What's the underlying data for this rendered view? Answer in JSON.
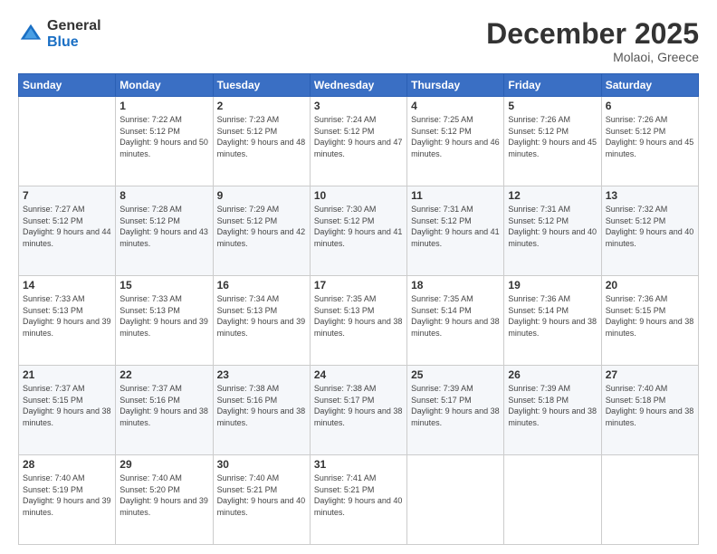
{
  "header": {
    "logo_line1": "General",
    "logo_line2": "Blue",
    "month": "December 2025",
    "location": "Molaoi, Greece"
  },
  "days_of_week": [
    "Sunday",
    "Monday",
    "Tuesday",
    "Wednesday",
    "Thursday",
    "Friday",
    "Saturday"
  ],
  "weeks": [
    [
      {
        "day": "",
        "sunrise": "",
        "sunset": "",
        "daylight": ""
      },
      {
        "day": "1",
        "sunrise": "Sunrise: 7:22 AM",
        "sunset": "Sunset: 5:12 PM",
        "daylight": "Daylight: 9 hours and 50 minutes."
      },
      {
        "day": "2",
        "sunrise": "Sunrise: 7:23 AM",
        "sunset": "Sunset: 5:12 PM",
        "daylight": "Daylight: 9 hours and 48 minutes."
      },
      {
        "day": "3",
        "sunrise": "Sunrise: 7:24 AM",
        "sunset": "Sunset: 5:12 PM",
        "daylight": "Daylight: 9 hours and 47 minutes."
      },
      {
        "day": "4",
        "sunrise": "Sunrise: 7:25 AM",
        "sunset": "Sunset: 5:12 PM",
        "daylight": "Daylight: 9 hours and 46 minutes."
      },
      {
        "day": "5",
        "sunrise": "Sunrise: 7:26 AM",
        "sunset": "Sunset: 5:12 PM",
        "daylight": "Daylight: 9 hours and 45 minutes."
      },
      {
        "day": "6",
        "sunrise": "Sunrise: 7:26 AM",
        "sunset": "Sunset: 5:12 PM",
        "daylight": "Daylight: 9 hours and 45 minutes."
      }
    ],
    [
      {
        "day": "7",
        "sunrise": "Sunrise: 7:27 AM",
        "sunset": "Sunset: 5:12 PM",
        "daylight": "Daylight: 9 hours and 44 minutes."
      },
      {
        "day": "8",
        "sunrise": "Sunrise: 7:28 AM",
        "sunset": "Sunset: 5:12 PM",
        "daylight": "Daylight: 9 hours and 43 minutes."
      },
      {
        "day": "9",
        "sunrise": "Sunrise: 7:29 AM",
        "sunset": "Sunset: 5:12 PM",
        "daylight": "Daylight: 9 hours and 42 minutes."
      },
      {
        "day": "10",
        "sunrise": "Sunrise: 7:30 AM",
        "sunset": "Sunset: 5:12 PM",
        "daylight": "Daylight: 9 hours and 41 minutes."
      },
      {
        "day": "11",
        "sunrise": "Sunrise: 7:31 AM",
        "sunset": "Sunset: 5:12 PM",
        "daylight": "Daylight: 9 hours and 41 minutes."
      },
      {
        "day": "12",
        "sunrise": "Sunrise: 7:31 AM",
        "sunset": "Sunset: 5:12 PM",
        "daylight": "Daylight: 9 hours and 40 minutes."
      },
      {
        "day": "13",
        "sunrise": "Sunrise: 7:32 AM",
        "sunset": "Sunset: 5:12 PM",
        "daylight": "Daylight: 9 hours and 40 minutes."
      }
    ],
    [
      {
        "day": "14",
        "sunrise": "Sunrise: 7:33 AM",
        "sunset": "Sunset: 5:13 PM",
        "daylight": "Daylight: 9 hours and 39 minutes."
      },
      {
        "day": "15",
        "sunrise": "Sunrise: 7:33 AM",
        "sunset": "Sunset: 5:13 PM",
        "daylight": "Daylight: 9 hours and 39 minutes."
      },
      {
        "day": "16",
        "sunrise": "Sunrise: 7:34 AM",
        "sunset": "Sunset: 5:13 PM",
        "daylight": "Daylight: 9 hours and 39 minutes."
      },
      {
        "day": "17",
        "sunrise": "Sunrise: 7:35 AM",
        "sunset": "Sunset: 5:13 PM",
        "daylight": "Daylight: 9 hours and 38 minutes."
      },
      {
        "day": "18",
        "sunrise": "Sunrise: 7:35 AM",
        "sunset": "Sunset: 5:14 PM",
        "daylight": "Daylight: 9 hours and 38 minutes."
      },
      {
        "day": "19",
        "sunrise": "Sunrise: 7:36 AM",
        "sunset": "Sunset: 5:14 PM",
        "daylight": "Daylight: 9 hours and 38 minutes."
      },
      {
        "day": "20",
        "sunrise": "Sunrise: 7:36 AM",
        "sunset": "Sunset: 5:15 PM",
        "daylight": "Daylight: 9 hours and 38 minutes."
      }
    ],
    [
      {
        "day": "21",
        "sunrise": "Sunrise: 7:37 AM",
        "sunset": "Sunset: 5:15 PM",
        "daylight": "Daylight: 9 hours and 38 minutes."
      },
      {
        "day": "22",
        "sunrise": "Sunrise: 7:37 AM",
        "sunset": "Sunset: 5:16 PM",
        "daylight": "Daylight: 9 hours and 38 minutes."
      },
      {
        "day": "23",
        "sunrise": "Sunrise: 7:38 AM",
        "sunset": "Sunset: 5:16 PM",
        "daylight": "Daylight: 9 hours and 38 minutes."
      },
      {
        "day": "24",
        "sunrise": "Sunrise: 7:38 AM",
        "sunset": "Sunset: 5:17 PM",
        "daylight": "Daylight: 9 hours and 38 minutes."
      },
      {
        "day": "25",
        "sunrise": "Sunrise: 7:39 AM",
        "sunset": "Sunset: 5:17 PM",
        "daylight": "Daylight: 9 hours and 38 minutes."
      },
      {
        "day": "26",
        "sunrise": "Sunrise: 7:39 AM",
        "sunset": "Sunset: 5:18 PM",
        "daylight": "Daylight: 9 hours and 38 minutes."
      },
      {
        "day": "27",
        "sunrise": "Sunrise: 7:40 AM",
        "sunset": "Sunset: 5:18 PM",
        "daylight": "Daylight: 9 hours and 38 minutes."
      }
    ],
    [
      {
        "day": "28",
        "sunrise": "Sunrise: 7:40 AM",
        "sunset": "Sunset: 5:19 PM",
        "daylight": "Daylight: 9 hours and 39 minutes."
      },
      {
        "day": "29",
        "sunrise": "Sunrise: 7:40 AM",
        "sunset": "Sunset: 5:20 PM",
        "daylight": "Daylight: 9 hours and 39 minutes."
      },
      {
        "day": "30",
        "sunrise": "Sunrise: 7:40 AM",
        "sunset": "Sunset: 5:21 PM",
        "daylight": "Daylight: 9 hours and 40 minutes."
      },
      {
        "day": "31",
        "sunrise": "Sunrise: 7:41 AM",
        "sunset": "Sunset: 5:21 PM",
        "daylight": "Daylight: 9 hours and 40 minutes."
      },
      {
        "day": "",
        "sunrise": "",
        "sunset": "",
        "daylight": ""
      },
      {
        "day": "",
        "sunrise": "",
        "sunset": "",
        "daylight": ""
      },
      {
        "day": "",
        "sunrise": "",
        "sunset": "",
        "daylight": ""
      }
    ]
  ]
}
